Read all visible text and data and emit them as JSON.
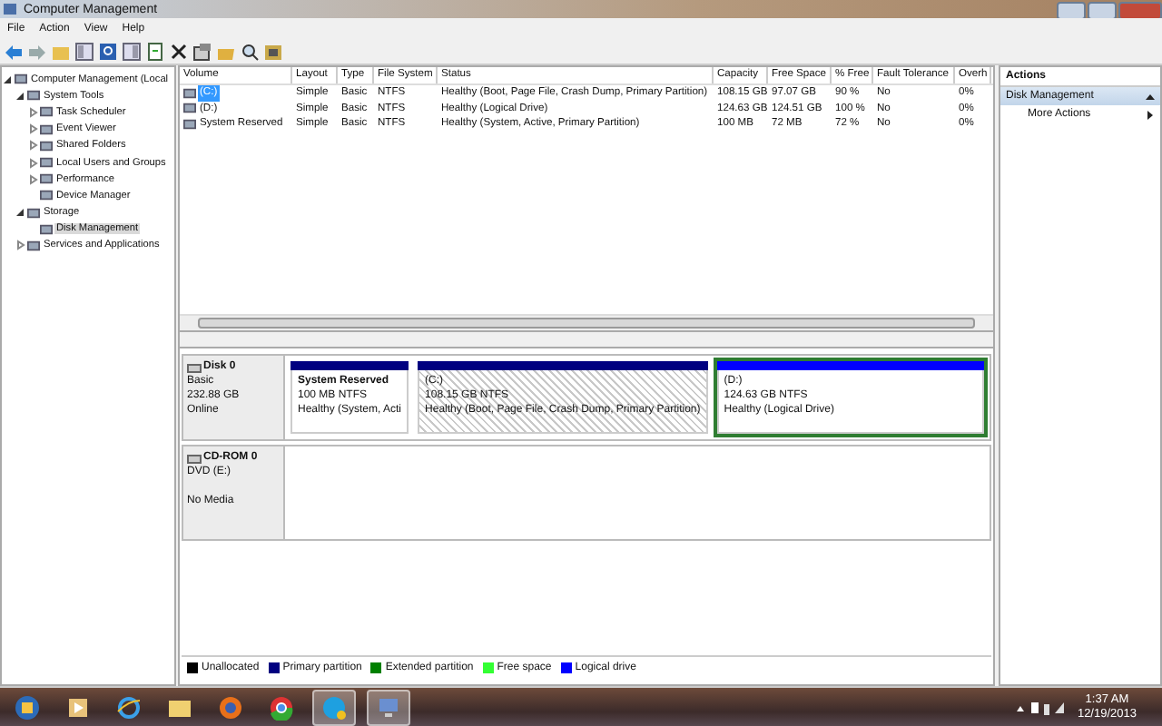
{
  "window": {
    "title": "Computer Management"
  },
  "menu": [
    "File",
    "Action",
    "View",
    "Help"
  ],
  "tree": [
    {
      "label": "Computer Management (Local",
      "expanded": true,
      "selected": false,
      "children": [
        {
          "label": "System Tools",
          "expanded": true,
          "selected": false,
          "children": [
            {
              "label": "Task Scheduler",
              "expanded": false,
              "selected": false
            },
            {
              "label": "Event Viewer",
              "expanded": false,
              "selected": false
            },
            {
              "label": "Shared Folders",
              "expanded": false,
              "selected": false
            },
            {
              "label": "Local Users and Groups",
              "expanded": false,
              "selected": false
            },
            {
              "label": "Performance",
              "expanded": false,
              "selected": false
            },
            {
              "label": "Device Manager",
              "selected": false
            }
          ]
        },
        {
          "label": "Storage",
          "expanded": true,
          "selected": false,
          "children": [
            {
              "label": "Disk Management",
              "selected": true
            }
          ]
        },
        {
          "label": "Services and Applications",
          "expanded": false,
          "selected": false
        }
      ]
    }
  ],
  "table": {
    "columns": [
      "Volume",
      "Layout",
      "Type",
      "File System",
      "Status",
      "Capacity",
      "Free Space",
      "% Free",
      "Fault Tolerance",
      "Overh"
    ],
    "rows": [
      {
        "selected": true,
        "cells": [
          "(C:)",
          "Simple",
          "Basic",
          "NTFS",
          "Healthy (Boot, Page File, Crash Dump, Primary Partition)",
          "108.15 GB",
          "97.07 GB",
          "90 %",
          "No",
          "0%"
        ]
      },
      {
        "selected": false,
        "cells": [
          "(D:)",
          "Simple",
          "Basic",
          "NTFS",
          "Healthy (Logical Drive)",
          "124.63 GB",
          "124.51 GB",
          "100 %",
          "No",
          "0%"
        ]
      },
      {
        "selected": false,
        "cells": [
          "System Reserved",
          "Simple",
          "Basic",
          "NTFS",
          "Healthy (System, Active, Primary Partition)",
          "100 MB",
          "72 MB",
          "72 %",
          "No",
          "0%"
        ]
      }
    ]
  },
  "disks": [
    {
      "kind": "disk",
      "name": "Disk 0",
      "lines": [
        "Basic",
        "232.88 GB",
        "Online"
      ],
      "partitions": [
        {
          "kind": "primary",
          "name": "System Reserved",
          "size": "100 MB NTFS",
          "status": "Healthy (System, Acti",
          "selected": false
        },
        {
          "kind": "primary",
          "name": "(C:)",
          "size": "108.15 GB NTFS",
          "status": "Healthy (Boot, Page File, Crash Dump, Primary Partition)",
          "selected": true
        },
        {
          "kind": "logical",
          "name": "(D:)",
          "size": "124.63 GB NTFS",
          "status": "Healthy (Logical Drive)",
          "selected": false
        }
      ]
    },
    {
      "kind": "cdrom",
      "name": "CD-ROM 0",
      "lines": [
        "DVD (E:)",
        "No Media"
      ]
    }
  ],
  "legend": [
    {
      "label": "Unallocated",
      "color": "#000000"
    },
    {
      "label": "Primary partition",
      "color": "#000080"
    },
    {
      "label": "Extended partition",
      "color": "#008000"
    },
    {
      "label": "Free space",
      "color": "#33ff33"
    },
    {
      "label": "Logical drive",
      "color": "#0000ff"
    }
  ],
  "actions": {
    "title": "Actions",
    "section": "Disk Management",
    "items": [
      "More Actions"
    ]
  },
  "taskbar": {
    "time": "1:37 AM",
    "date": "12/19/2013"
  }
}
